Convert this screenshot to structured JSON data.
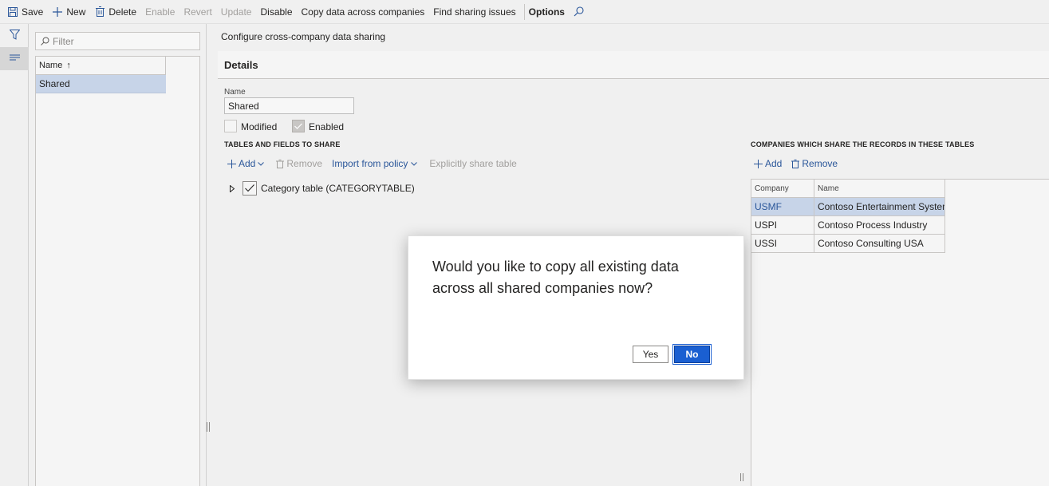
{
  "toolbar": {
    "save": "Save",
    "new": "New",
    "delete": "Delete",
    "enable": "Enable",
    "revert": "Revert",
    "update": "Update",
    "disable": "Disable",
    "copy_data": "Copy data across companies",
    "find_issues": "Find sharing issues",
    "options": "Options"
  },
  "list": {
    "filter_placeholder": "Filter",
    "column_name": "Name",
    "sort_indicator": "↑",
    "rows": [
      "Shared"
    ]
  },
  "main": {
    "breadcrumb": "Configure cross-company data sharing",
    "details_header": "Details",
    "name_label": "Name",
    "name_value": "Shared",
    "modified_label": "Modified",
    "enabled_label": "Enabled"
  },
  "tables_section": {
    "title": "TABLES AND FIELDS TO SHARE",
    "add": "Add",
    "remove": "Remove",
    "import_from_policy": "Import from policy",
    "explicitly_share": "Explicitly share table",
    "tree_items": [
      "Category table (CATEGORYTABLE)"
    ]
  },
  "companies_section": {
    "title": "COMPANIES WHICH SHARE THE RECORDS IN THESE TABLES",
    "add": "Add",
    "remove": "Remove",
    "columns": [
      "Company",
      "Name"
    ],
    "rows": [
      {
        "company": "USMF",
        "name": "Contoso Entertainment System ..."
      },
      {
        "company": "USPI",
        "name": "Contoso Process Industry"
      },
      {
        "company": "USSI",
        "name": "Contoso Consulting USA"
      }
    ]
  },
  "dialog": {
    "message": "Would you like to copy all existing data across all shared companies now?",
    "yes": "Yes",
    "no": "No"
  },
  "colors": {
    "accent": "#2b579a",
    "selection": "#c7d4e8",
    "primary_button": "#1a5fd1"
  }
}
